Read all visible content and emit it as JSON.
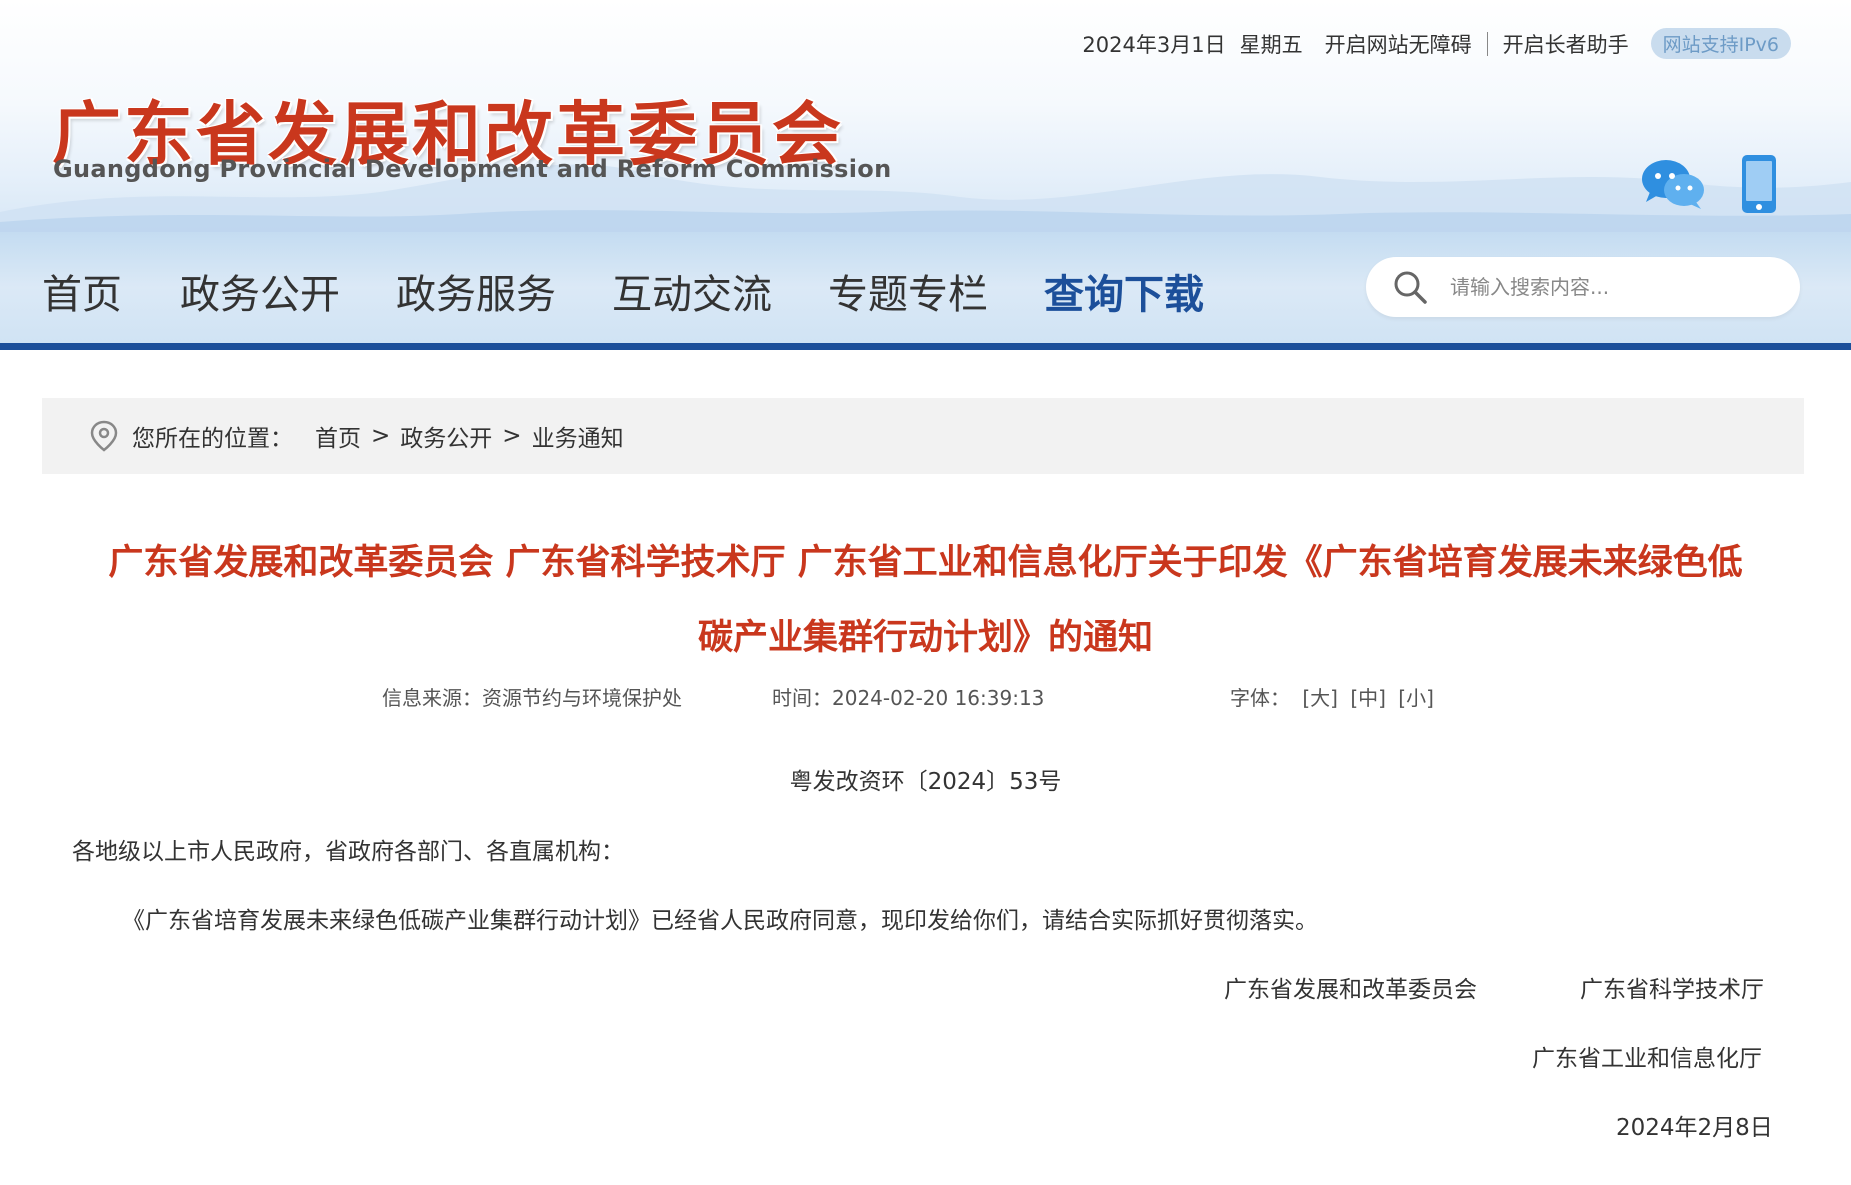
{
  "topbar": {
    "date": "2024年3月1日",
    "weekday": "星期五",
    "accessibility_link": "开启网站无障碍",
    "elder_link": "开启长者助手",
    "ipv6_badge": "网站支持IPv6"
  },
  "logo": {
    "cn": "广东省发展和改革委员会",
    "en": "Guangdong Provincial Development and Reform Commission"
  },
  "nav": {
    "items": [
      {
        "label": "首页"
      },
      {
        "label": "政务公开"
      },
      {
        "label": "政务服务"
      },
      {
        "label": "互动交流"
      },
      {
        "label": "专题专栏"
      },
      {
        "label": "查询下载"
      }
    ],
    "active_index": 5
  },
  "search": {
    "placeholder": "请输入搜索内容..."
  },
  "breadcrumb": {
    "lead": "您所在的位置：",
    "crumbs": [
      "首页",
      "政务公开",
      "业务通知"
    ],
    "separator": ">"
  },
  "article": {
    "title_line1": "广东省发展和改革委员会 广东省科学技术厅 广东省工业和信息化厅关于印发《广东省培育发展未来绿色低",
    "title_line2": "碳产业集群行动计划》的通知",
    "source": "信息来源：资源节约与环境保护处",
    "time": "时间：2024-02-20 16:39:13",
    "font_label": "字体：",
    "font_large": "[大]",
    "font_medium": "[中]",
    "font_small": "[小]",
    "doc_number": "粤发改资环〔2024〕53号",
    "recipients": "各地级以上市人民政府，省政府各部门、各直属机构：",
    "body": "《广东省培育发展未来绿色低碳产业集群行动计划》已经省人民政府同意，现印发给你们，请结合实际抓好贯彻落实。",
    "signer_1": "广东省发展和改革委员会",
    "signer_2": "广东省科学技术厅",
    "signer_3": "广东省工业和信息化厅",
    "sign_date": "2024年2月8日"
  },
  "colors": {
    "brand_red": "#c9371d",
    "nav_blue": "#1c4f9a",
    "nav_bg": "#d0e3f4"
  }
}
